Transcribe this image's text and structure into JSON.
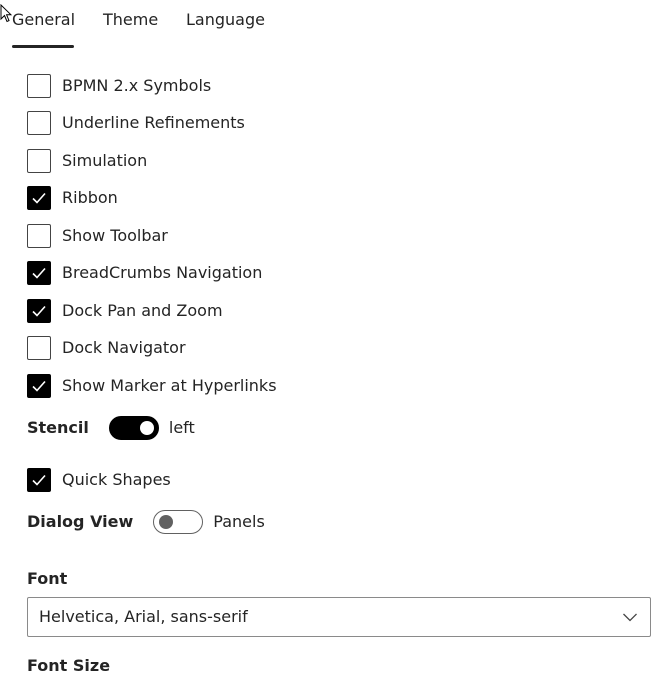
{
  "tabs": [
    {
      "label": "General",
      "selected": true
    },
    {
      "label": "Theme",
      "selected": false
    },
    {
      "label": "Language",
      "selected": false
    }
  ],
  "options": [
    {
      "label": "BPMN 2.x Symbols",
      "checked": false
    },
    {
      "label": "Underline Refinements",
      "checked": false
    },
    {
      "label": "Simulation",
      "checked": false
    },
    {
      "label": "Ribbon",
      "checked": true
    },
    {
      "label": "Show Toolbar",
      "checked": false
    },
    {
      "label": "BreadCrumbs Navigation",
      "checked": true
    },
    {
      "label": "Dock Pan and Zoom",
      "checked": true
    },
    {
      "label": "Dock Navigator",
      "checked": false
    },
    {
      "label": "Show Marker at Hyperlinks",
      "checked": true
    }
  ],
  "stencil": {
    "label": "Stencil",
    "on": true,
    "value": "left"
  },
  "quick_shapes": {
    "label": "Quick Shapes",
    "checked": true
  },
  "dialog_view": {
    "label": "Dialog View",
    "on": false,
    "value": "Panels"
  },
  "font": {
    "label": "Font",
    "value": "Helvetica, Arial, sans-serif"
  },
  "font_size": {
    "label": "Font Size"
  },
  "colors": {
    "accent": "#000000",
    "text": "#242424",
    "border": "#8a8a8a"
  }
}
